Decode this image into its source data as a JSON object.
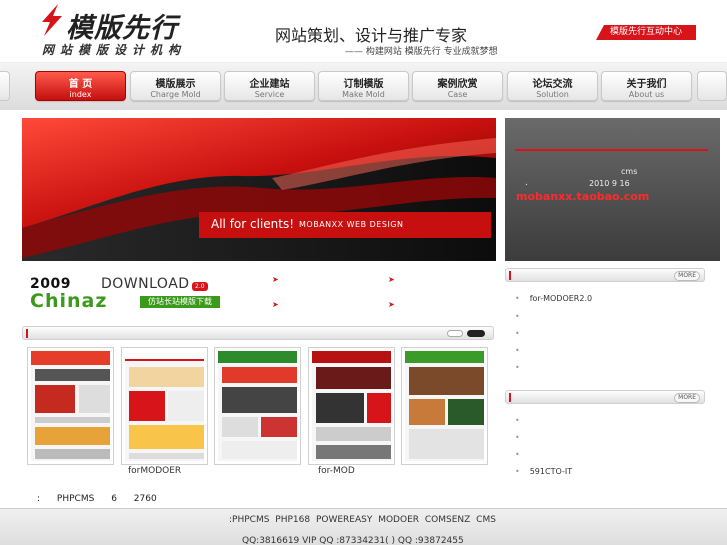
{
  "header": {
    "logo_title": "模版先行",
    "logo_sub": "网站模版设计机构",
    "slogan": "网站策划、设计与推广专家",
    "slogan_sub": "—— 构建网站 模版先行 专业成就梦想",
    "hub_label": "模版先行互动中心"
  },
  "nav": [
    {
      "cn": "首 页",
      "en": "index"
    },
    {
      "cn": "模版展示",
      "en": "Charge Mold"
    },
    {
      "cn": "企业建站",
      "en": "Service"
    },
    {
      "cn": "订制模版",
      "en": "Make Mold"
    },
    {
      "cn": "案例欣赏",
      "en": "Case"
    },
    {
      "cn": "论坛交流",
      "en": "Solution"
    },
    {
      "cn": "关于我们",
      "en": "About us"
    }
  ],
  "banner": {
    "text_a": "All for clients!",
    "text_b": "MOBANXX WEB DESIGN"
  },
  "info": {
    "cms": "cms",
    "dot": ".",
    "date": "2010 9 16",
    "shop": "mobanxx.taobao.com"
  },
  "download": {
    "year": "2009",
    "word": "DOWNLOAD",
    "version": "2.0",
    "brand": "Chinaz",
    "caption": "仿站长站模版下载"
  },
  "more_label": "MORE",
  "right_list_1": [
    "for-MODOER2.0",
    "",
    "",
    "",
    ""
  ],
  "right_list_2": [
    "",
    "",
    "",
    "591CTO-IT"
  ],
  "thumb_captions": [
    "forMODOER",
    "for-MOD"
  ],
  "stats": {
    "a": ":",
    "b": "PHPCMS",
    "c": "6",
    "d": "2760"
  },
  "footer": {
    "line1": ":PHPCMS PHP168  POWEREASY  MODOER COMSENZ    CMS",
    "line2": "QQ:3816619   VIP  QQ :87334231(        )     QQ :93872455"
  },
  "colors": {
    "accent": "#d7141a",
    "green": "#3b9a1c"
  }
}
